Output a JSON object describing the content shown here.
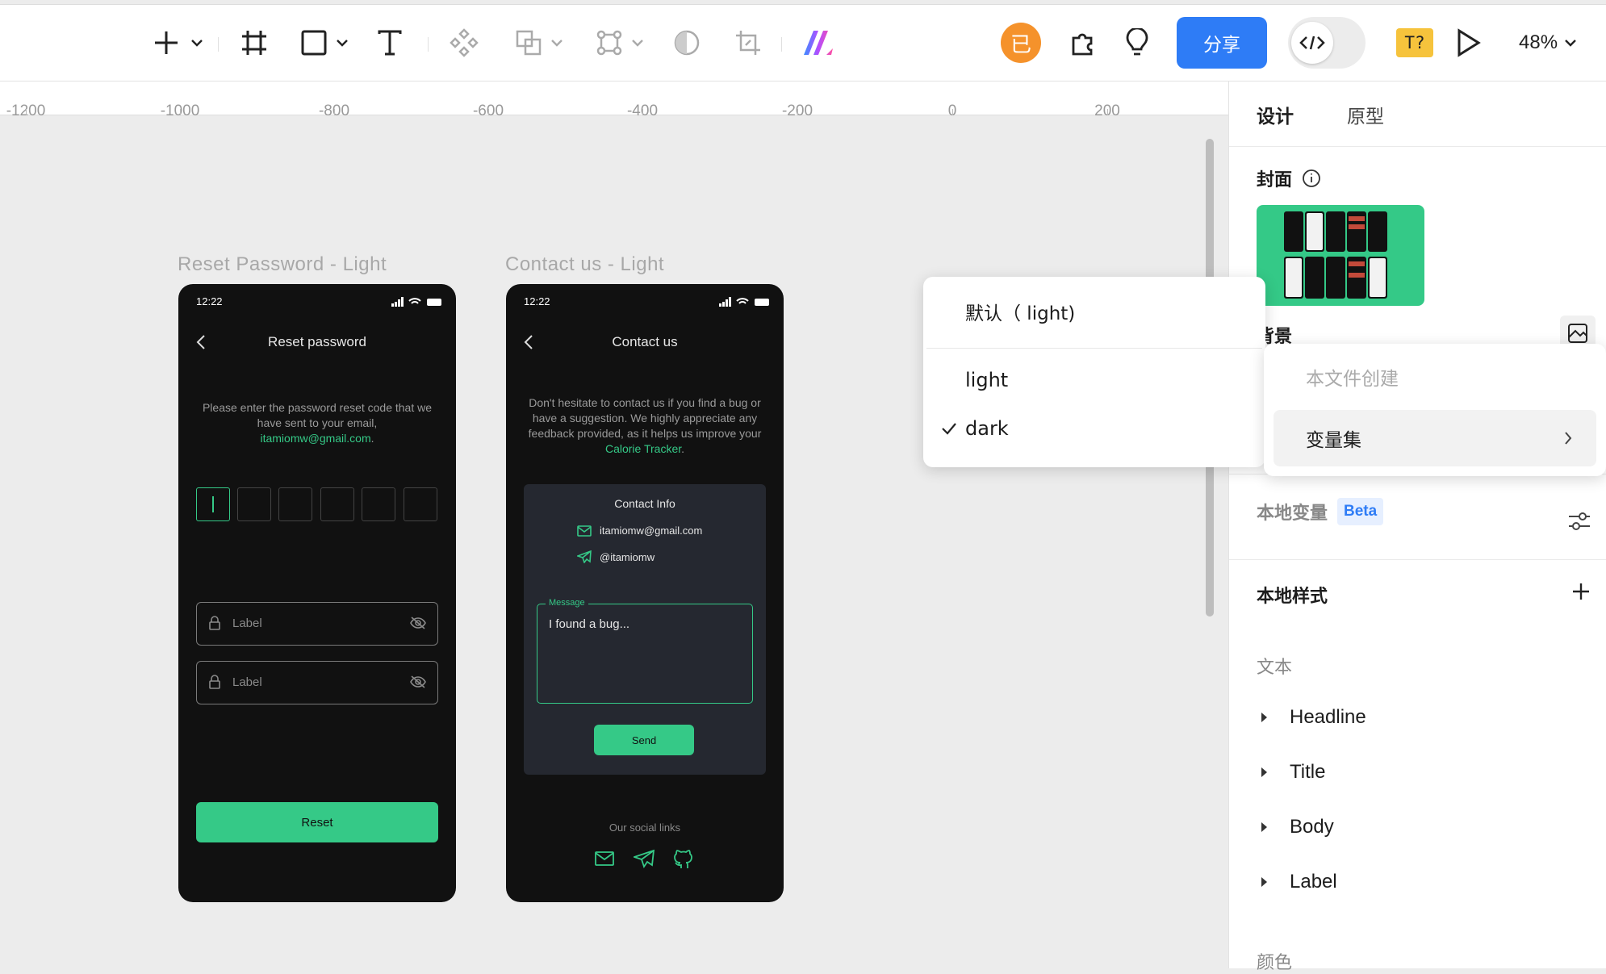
{
  "toolbar": {
    "avatar_char": "已",
    "share_label": "分享",
    "text_badge": "T?",
    "zoom": "48%",
    "accent": "#2e7cf6"
  },
  "ruler": {
    "ticks": [
      "-1200",
      "-1000",
      "-800",
      "-600",
      "-400",
      "-200",
      "0",
      "200"
    ]
  },
  "frames": [
    {
      "label": "Reset Password - Light",
      "time": "12:22",
      "title": "Reset password",
      "desc_pre": "Please enter the password reset code that we have sent to your email,",
      "desc_link": "itamiomw@gmail.com",
      "desc_post": ".",
      "field1_label": "Label",
      "field2_label": "Label",
      "button": "Reset"
    },
    {
      "label": "Contact us - Light",
      "time": "12:22",
      "title": "Contact us",
      "desc_pre": "Don't hesitate to contact us if you find a bug or have a suggestion. We highly appreciate any feedback provided, as it helps us improve your",
      "desc_link": "Calorie Tracker",
      "desc_post": ".",
      "card_title": "Contact Info",
      "email": "itamiomw@gmail.com",
      "telegram": "@itamiomw",
      "message_label": "Message",
      "message_value": "I found a bug...",
      "send": "Send",
      "social_title": "Our social links"
    }
  ],
  "panel": {
    "tabs": [
      "设计",
      "原型"
    ],
    "cover_label": "封面",
    "background_label": "背景",
    "local_vars_label": "本地变量",
    "beta": "Beta",
    "local_styles_label": "本地样式",
    "text_group": "文本",
    "text_styles": [
      "Headline",
      "Title",
      "Body",
      "Label"
    ],
    "color_group": "颜色"
  },
  "menu_theme": {
    "default_item": "默认（ light)",
    "items": [
      "light",
      "dark"
    ],
    "checked": "dark"
  },
  "menu_source": {
    "disabled_item": "本文件创建",
    "submenu_item": "变量集"
  },
  "colors": {
    "brand_green": "#35c987",
    "phone_bg": "#111111",
    "card_bg": "#252830"
  }
}
